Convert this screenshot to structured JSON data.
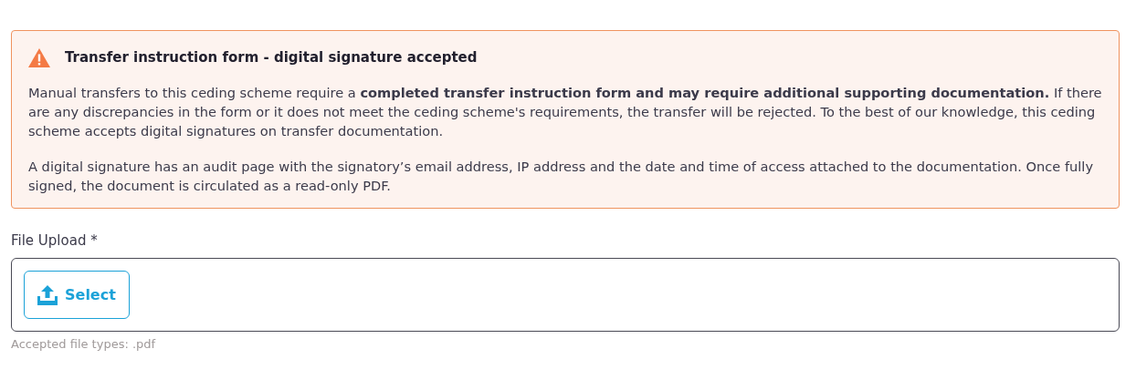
{
  "alert": {
    "title": "Transfer instruction form - digital signature accepted",
    "paragraphs": [
      "Manual transfers to this ceding scheme require a **completed transfer instruction form and may require additional supporting documentation.** If there are any discrepancies in the form or it does not meet the ceding scheme's requirements, the transfer will be rejected. To the best of our knowledge, this ceding scheme accepts digital signatures on transfer documentation.",
      "A digital signature has an audit page with the signatory’s email address, IP address and the date and time of access attached to the documentation. Once fully signed, the document is circulated as a read-only PDF."
    ]
  },
  "upload": {
    "label": "File Upload",
    "required_mark": "*",
    "button": "Select",
    "hint": "Accepted file types: .pdf"
  }
}
